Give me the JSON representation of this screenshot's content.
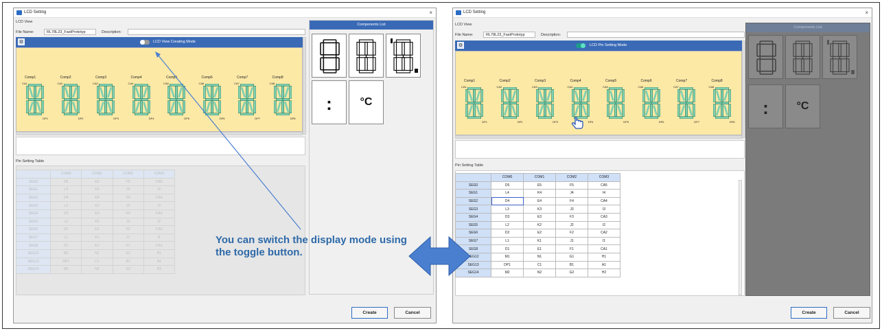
{
  "left_dialog": {
    "title": "LCD Setting",
    "lcd_view_label": "LCD View",
    "file_name_label": "File Name:",
    "file_name_value": "RL78L23_FastPrototyp",
    "description_label": "Description:",
    "description_value": "",
    "toggle_label": "LCD View Creating Mode",
    "toggle_on": false,
    "pin_table_label": "Pin Setting Table",
    "components_list_label": "Components List",
    "create_label": "Create",
    "cancel_label": "Cancel"
  },
  "right_dialog": {
    "title": "LCD Setting",
    "lcd_view_label": "LCD View",
    "file_name_label": "File Name:",
    "file_name_value": "RL78L23_FastPrototyp",
    "description_label": "Description:",
    "description_value": "",
    "toggle_label": "LCD Pin Setting Mode",
    "toggle_on": true,
    "pin_table_label": "Pin Setting Table",
    "components_list_label": "Components List",
    "create_label": "Create",
    "cancel_label": "Cancel"
  },
  "components": [
    {
      "name": "Comp1",
      "ca": "CA1",
      "dp": "DP1"
    },
    {
      "name": "Comp2",
      "ca": "CA2",
      "dp": "DP2"
    },
    {
      "name": "Comp3",
      "ca": "CA3",
      "dp": "DP3"
    },
    {
      "name": "Comp4",
      "ca": "CA4",
      "dp": "DP4"
    },
    {
      "name": "Comp5",
      "ca": "CA5",
      "dp": "DP5"
    },
    {
      "name": "Comp6",
      "ca": "CA6",
      "dp": "DP6"
    },
    {
      "name": "Comp7",
      "ca": "CA7",
      "dp": "DP7"
    },
    {
      "name": "Comp8",
      "ca": "CA8",
      "dp": "DP8"
    }
  ],
  "component_tiles": {
    "colon": ":",
    "celsius": "°C"
  },
  "pin_table": {
    "columns": [
      "COM0",
      "COM1",
      "COM2",
      "COM3"
    ],
    "rows": [
      {
        "seg": "SEG0",
        "cells": [
          "D5",
          "E5",
          "F5",
          "CA5"
        ]
      },
      {
        "seg": "SEG1",
        "cells": [
          "L4",
          "K4",
          "J4",
          "I4"
        ]
      },
      {
        "seg": "SEG2",
        "cells": [
          "D4",
          "E4",
          "F4",
          "CA4"
        ]
      },
      {
        "seg": "SEG3",
        "cells": [
          "L3",
          "K3",
          "J3",
          "I3"
        ]
      },
      {
        "seg": "SEG4",
        "cells": [
          "D3",
          "E3",
          "F3",
          "CA3"
        ]
      },
      {
        "seg": "SEG5",
        "cells": [
          "L2",
          "K2",
          "J2",
          "I2"
        ]
      },
      {
        "seg": "SEG6",
        "cells": [
          "D2",
          "E2",
          "F2",
          "CA2"
        ]
      },
      {
        "seg": "SEG7",
        "cells": [
          "L1",
          "K1",
          "J1",
          "I1"
        ]
      },
      {
        "seg": "SEG8",
        "cells": [
          "D1",
          "E1",
          "F1",
          "CA1"
        ]
      },
      {
        "seg": "SEG12",
        "cells": [
          "M1",
          "N1",
          "G1",
          "H1"
        ]
      },
      {
        "seg": "SEG13",
        "cells": [
          "DP1",
          "C1",
          "B1",
          "A1"
        ]
      },
      {
        "seg": "SEG14",
        "cells": [
          "M2",
          "N2",
          "G2",
          "H2"
        ]
      }
    ]
  },
  "callout_text": "You can switch the display mode using the toggle button.",
  "colors": {
    "accent_blue": "#3a6ab6",
    "lcd_background": "#fde9a6",
    "segment_green": "#7fcfb0",
    "toggle_on": "#1f9b8a",
    "callout_text": "#2e6aa8",
    "arrow_fill": "#4a7fd0"
  },
  "icons": {
    "settings": "gear-icon",
    "pointer": "hand-pointer-icon",
    "switch": "double-arrow-icon"
  }
}
